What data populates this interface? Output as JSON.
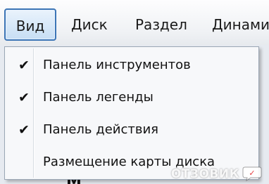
{
  "menubar": {
    "items": [
      {
        "label": "Вид"
      },
      {
        "label": "Диск"
      },
      {
        "label": "Раздел"
      },
      {
        "label": "Динами"
      }
    ]
  },
  "dropdown": {
    "items": [
      {
        "label": "Панель инструментов",
        "checked": true
      },
      {
        "label": "Панель легенды",
        "checked": true
      },
      {
        "label": "Панель действия",
        "checked": true
      },
      {
        "label": "Размещение карты диска",
        "checked": false
      }
    ],
    "check_glyph": "✔"
  },
  "background": {
    "partial_text": "М"
  },
  "watermark": {
    "text": "ОТЗОВИК"
  },
  "colors": {
    "active_border": "#3c75b6",
    "active_fill": "#c7def4"
  }
}
